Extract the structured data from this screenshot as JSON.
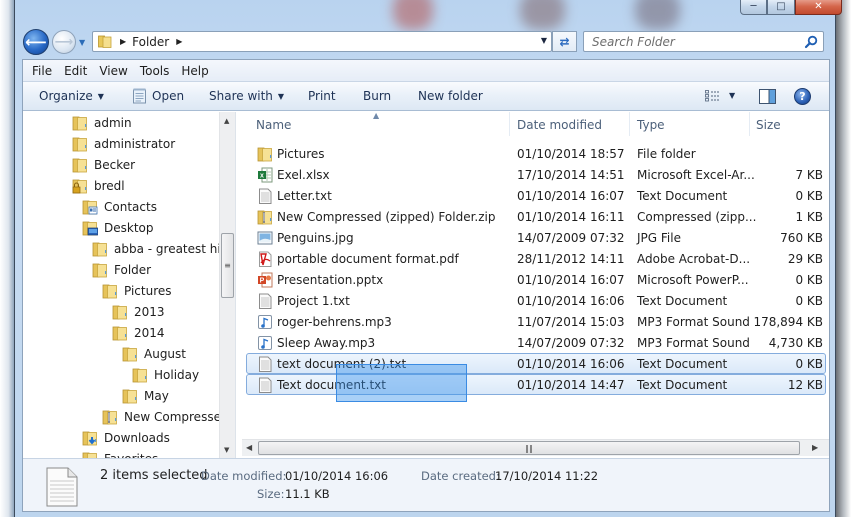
{
  "window": {
    "caption_buttons": {
      "minimize": "minimize-icon",
      "maximize": "maximize-icon",
      "close": "close-icon"
    }
  },
  "navbar": {
    "back_icon": "back-arrow-icon",
    "forward_icon": "forward-arrow-icon",
    "breadcrumb": [
      "Folder"
    ],
    "search_placeholder": "Search Folder"
  },
  "menubar": [
    "File",
    "Edit",
    "View",
    "Tools",
    "Help"
  ],
  "commandbar": {
    "organize": "Organize",
    "open": "Open",
    "share_with": "Share with",
    "print": "Print",
    "burn": "Burn",
    "new_folder": "New folder"
  },
  "nav_tree": [
    {
      "label": "admin",
      "icon": "folder-icon",
      "level": 0
    },
    {
      "label": "administrator",
      "icon": "folder-icon",
      "level": 0
    },
    {
      "label": "Becker",
      "icon": "folder-icon",
      "level": 0
    },
    {
      "label": "bredl",
      "icon": "locked-folder-icon",
      "level": 0
    },
    {
      "label": "Contacts",
      "icon": "contacts-folder-icon",
      "level": 1
    },
    {
      "label": "Desktop",
      "icon": "desktop-folder-icon",
      "level": 1
    },
    {
      "label": "abba - greatest hits",
      "icon": "folder-icon",
      "level": 2
    },
    {
      "label": "Folder",
      "icon": "folder-icon",
      "level": 2
    },
    {
      "label": "Pictures",
      "icon": "folder-icon",
      "level": 3
    },
    {
      "label": "2013",
      "icon": "folder-icon",
      "level": 4
    },
    {
      "label": "2014",
      "icon": "folder-icon",
      "level": 4
    },
    {
      "label": "August",
      "icon": "folder-icon",
      "level": 5
    },
    {
      "label": "Holiday",
      "icon": "folder-icon",
      "level": 6
    },
    {
      "label": "May",
      "icon": "folder-icon",
      "level": 5
    },
    {
      "label": "New Compressed",
      "icon": "zip-folder-icon",
      "level": 3
    },
    {
      "label": "Downloads",
      "icon": "downloads-folder-icon",
      "level": 1
    },
    {
      "label": "Favorites",
      "icon": "favorites-folder-icon",
      "level": 1
    }
  ],
  "columns": {
    "name": "Name",
    "date": "Date modified",
    "type": "Type",
    "size": "Size"
  },
  "files": [
    {
      "name": "Pictures",
      "date": "01/10/2014 18:57",
      "type": "File folder",
      "size": "",
      "icon": "folder-icon",
      "selected": false
    },
    {
      "name": "Exel.xlsx",
      "date": "17/10/2014 14:51",
      "type": "Microsoft Excel-Ar...",
      "size": "7 KB",
      "icon": "excel-file-icon",
      "selected": false
    },
    {
      "name": "Letter.txt",
      "date": "01/10/2014 16:07",
      "type": "Text Document",
      "size": "0 KB",
      "icon": "text-file-icon",
      "selected": false
    },
    {
      "name": "New Compressed (zipped) Folder.zip",
      "date": "01/10/2014 16:11",
      "type": "Compressed (zipp...",
      "size": "1 KB",
      "icon": "zip-folder-icon",
      "selected": false
    },
    {
      "name": "Penguins.jpg",
      "date": "14/07/2009 07:32",
      "type": "JPG File",
      "size": "760 KB",
      "icon": "image-file-icon",
      "selected": false
    },
    {
      "name": "portable document format.pdf",
      "date": "28/11/2012 14:11",
      "type": "Adobe Acrobat-D...",
      "size": "29 KB",
      "icon": "pdf-file-icon",
      "selected": false
    },
    {
      "name": "Presentation.pptx",
      "date": "01/10/2014 16:07",
      "type": "Microsoft PowerP...",
      "size": "0 KB",
      "icon": "powerpoint-file-icon",
      "selected": false
    },
    {
      "name": "Project 1.txt",
      "date": "01/10/2014 16:06",
      "type": "Text Document",
      "size": "0 KB",
      "icon": "text-file-icon",
      "selected": false
    },
    {
      "name": "roger-behrens.mp3",
      "date": "11/07/2014 15:03",
      "type": "MP3 Format Sound",
      "size": "178,894 KB",
      "icon": "audio-file-icon",
      "selected": false
    },
    {
      "name": "Sleep Away.mp3",
      "date": "14/07/2009 07:32",
      "type": "MP3 Format Sound",
      "size": "4,730 KB",
      "icon": "audio-file-icon",
      "selected": false
    },
    {
      "name": "text document (2).txt",
      "date": "01/10/2014 16:06",
      "type": "Text Document",
      "size": "0 KB",
      "icon": "text-file-icon",
      "selected": true
    },
    {
      "name": "Text document.txt",
      "date": "01/10/2014 14:47",
      "type": "Text Document",
      "size": "12 KB",
      "icon": "text-file-icon",
      "selected": true
    }
  ],
  "details": {
    "count": "2 items selected",
    "date_modified_label": "Date modified:",
    "date_modified": "01/10/2014 16:06",
    "date_created_label": "Date created:",
    "date_created": "17/10/2014 11:22",
    "size_label": "Size:",
    "size": "11.1 KB"
  },
  "colors": {
    "selection_fill": "#dbe9f9",
    "selection_border": "#84acdd",
    "marquee": "#338fec"
  }
}
